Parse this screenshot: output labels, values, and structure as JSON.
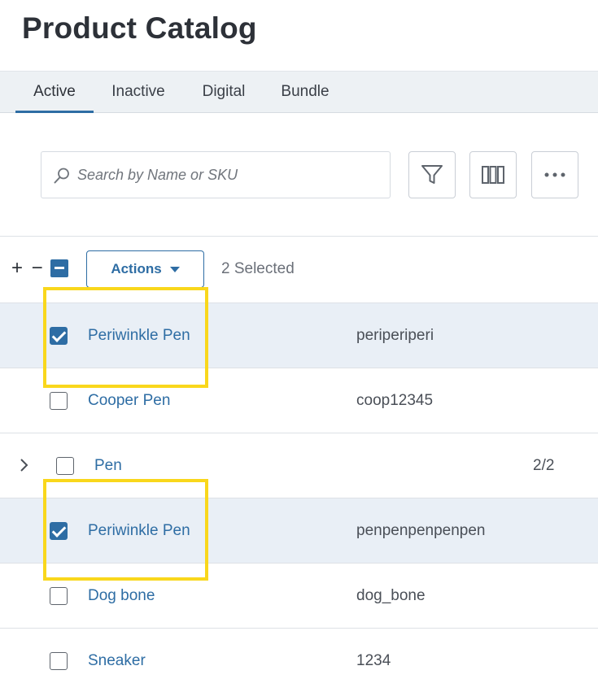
{
  "header": {
    "title": "Product Catalog"
  },
  "tabs": [
    {
      "label": "Active",
      "active": true
    },
    {
      "label": "Inactive",
      "active": false
    },
    {
      "label": "Digital",
      "active": false
    },
    {
      "label": "Bundle",
      "active": false
    }
  ],
  "toolbar": {
    "search_placeholder": "Search by Name or SKU",
    "search_value": "",
    "filter_icon": "filter-icon",
    "columns_icon": "columns-icon",
    "more_icon": "more-horizontal-icon"
  },
  "bulk": {
    "expand_collapse": "+ −",
    "actions_label": "Actions",
    "selected_text": "2 Selected"
  },
  "rows": [
    {
      "name": "Periwinkle Pen",
      "sku": "periperiperi",
      "checked": true
    },
    {
      "name": "Cooper Pen",
      "sku": "coop12345",
      "checked": false
    },
    {
      "name": "Pen",
      "count": "2/2",
      "checked": false,
      "group": true
    },
    {
      "name": "Periwinkle Pen",
      "sku": "penpenpenpenpen",
      "checked": true
    },
    {
      "name": "Dog bone",
      "sku": "dog_bone",
      "checked": false
    },
    {
      "name": "Sneaker",
      "sku": "1234",
      "checked": false
    }
  ],
  "colors": {
    "accent": "#2e6da4",
    "highlight": "#f9d71c",
    "selected_row": "#e9eff6"
  }
}
